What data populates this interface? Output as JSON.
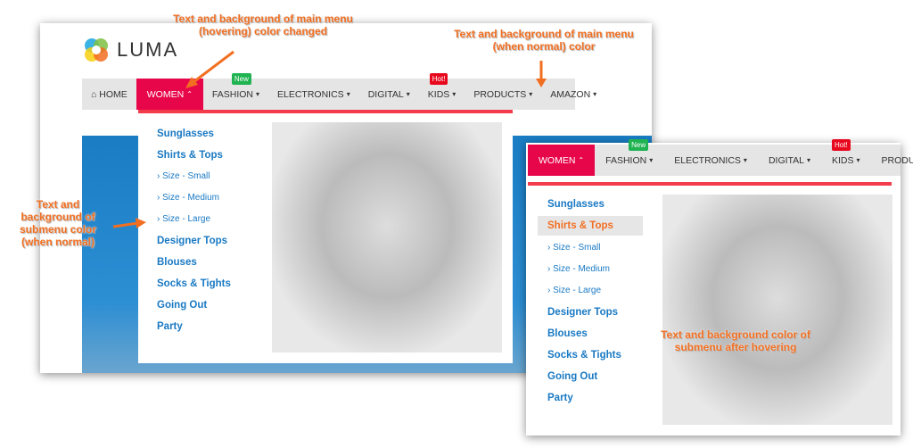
{
  "brand": {
    "name": "LUMA"
  },
  "colors": {
    "menu_hover_bg": "#e8064a",
    "menu_bg": "#e5e5e5",
    "submenu_text": "#1979c3",
    "submenu_hover_text": "#f26f23",
    "accent_line": "#f23c4c"
  },
  "menu": [
    {
      "label": "HOME",
      "icon": "home-icon"
    },
    {
      "label": "WOMEN",
      "chevron": "up"
    },
    {
      "label": "FASHION",
      "badge": "New"
    },
    {
      "label": "ELECTRONICS"
    },
    {
      "label": "DIGITAL"
    },
    {
      "label": "KIDS",
      "badge": "Hot!"
    },
    {
      "label": "PRODUCTS"
    },
    {
      "label": "AMAZON"
    }
  ],
  "submenu": [
    "Sunglasses",
    "Shirts & Tops",
    "› Size - Small",
    "› Size - Medium",
    "› Size - Large",
    "Designer Tops",
    "Blouses",
    "Socks & Tights",
    "Going Out",
    "Party"
  ],
  "annotations": {
    "hover_main": "Text and background of main menu (hovering) color changed",
    "normal_main": "Text and background of main menu (when normal) color",
    "normal_sub": "Text and background of submenu color (when normal)",
    "hover_sub": "Text and background color of submenu after hovering"
  }
}
